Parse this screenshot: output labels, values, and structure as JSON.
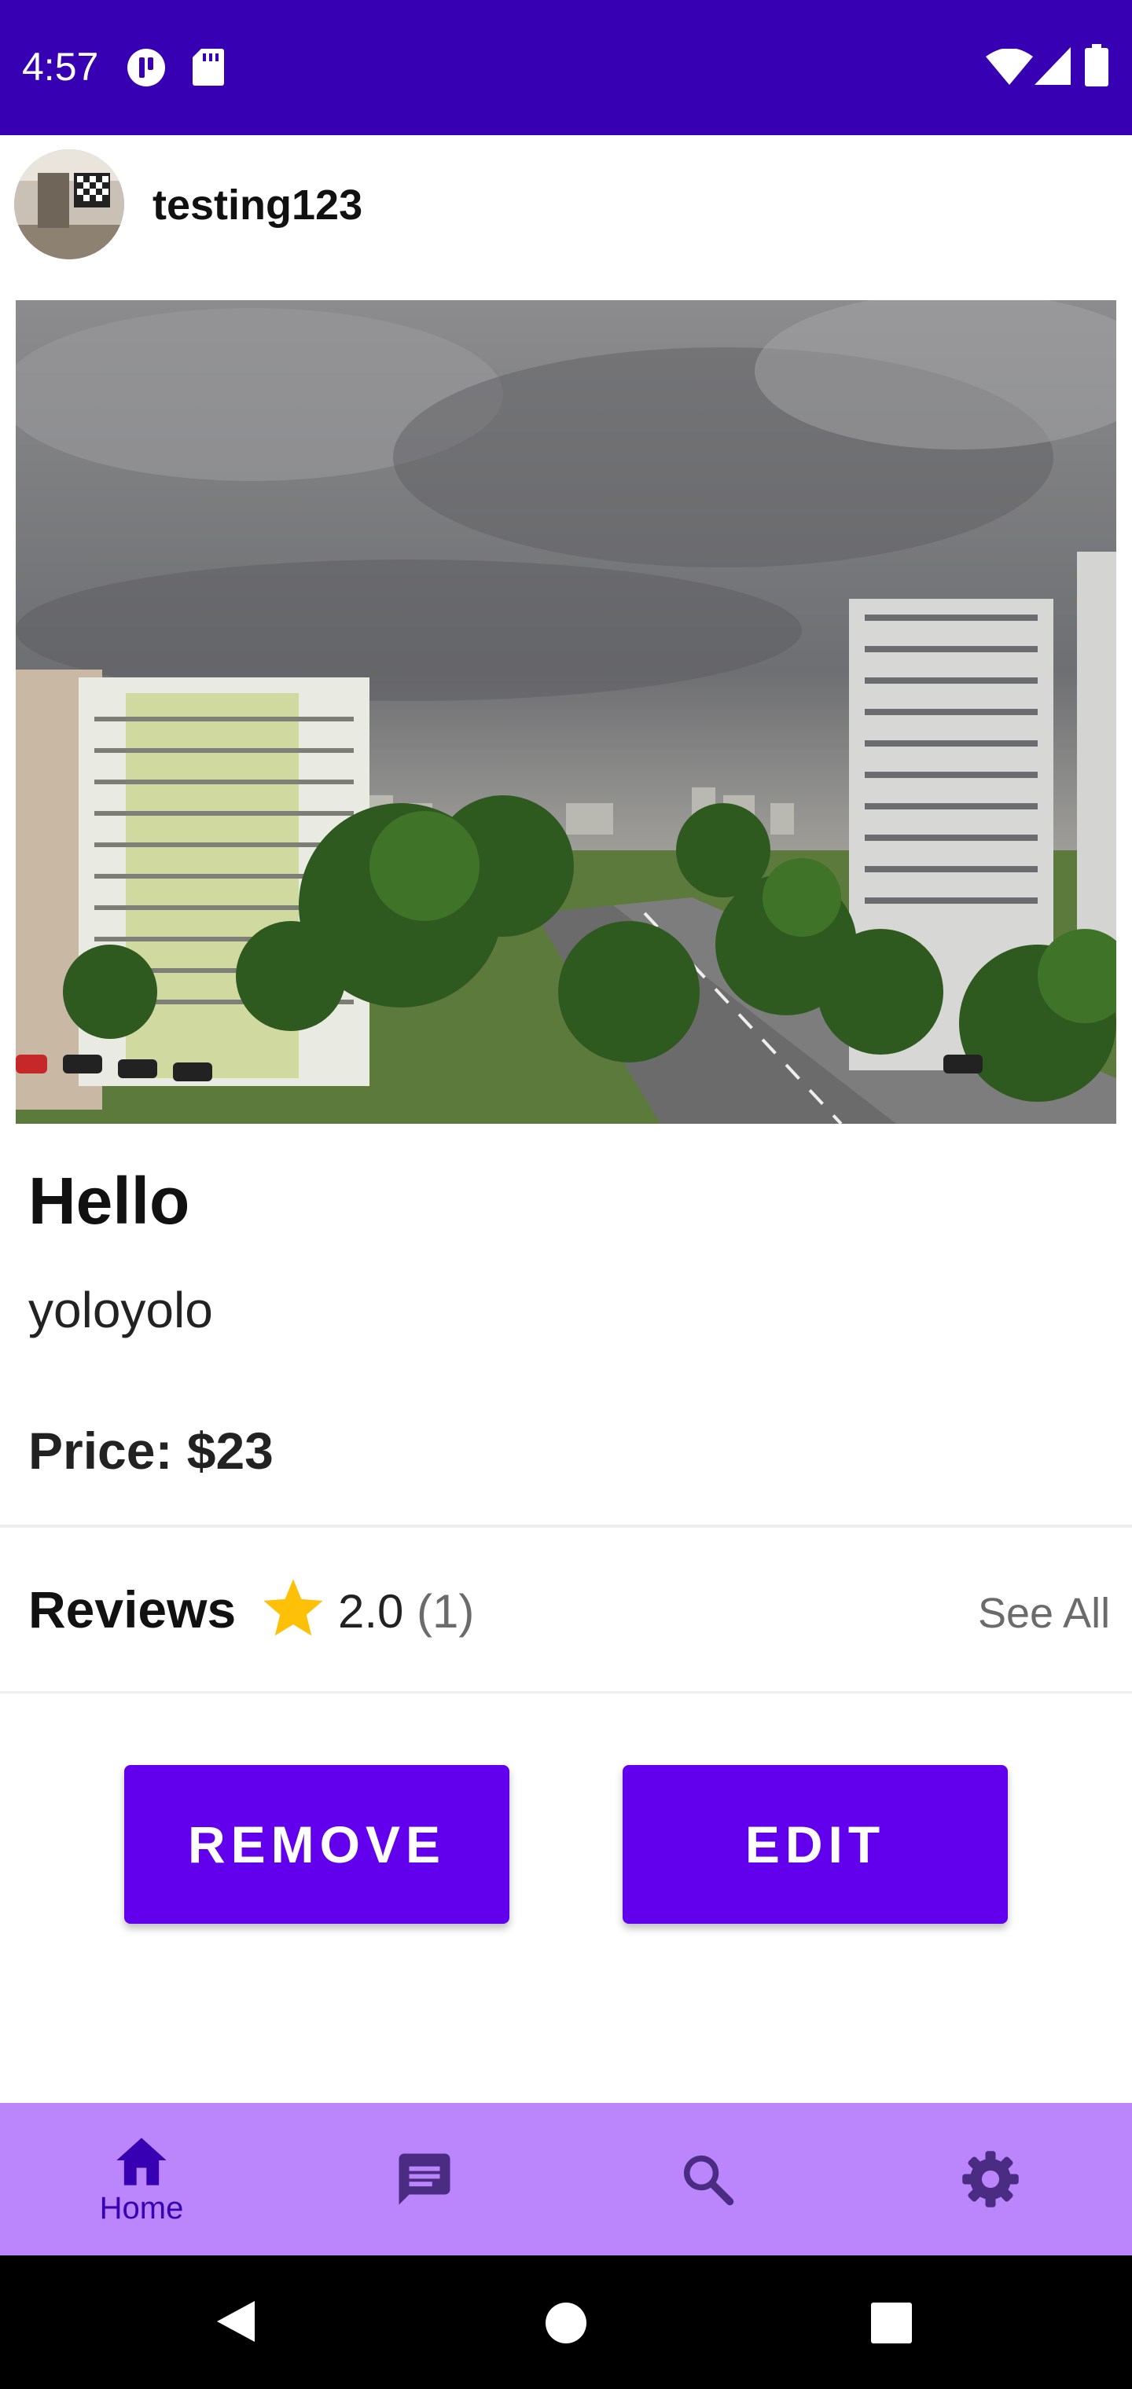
{
  "status_bar": {
    "time": "4:57",
    "icons": [
      "app-notification-icon",
      "sd-card-icon",
      "wifi-icon",
      "cellular-signal-icon",
      "battery-icon"
    ]
  },
  "post": {
    "username": "testing123",
    "title": "Hello",
    "description": "yoloyolo",
    "price": "Price: $23"
  },
  "reviews": {
    "label": "Reviews",
    "rating": "2.0",
    "count": "(1)",
    "see_all": "See All"
  },
  "actions": {
    "remove_label": "REMOVE",
    "edit_label": "EDIT"
  },
  "bottom_nav": {
    "items": [
      {
        "icon": "home-icon",
        "label": "Home",
        "active": true
      },
      {
        "icon": "chat-icon",
        "label": ""
      },
      {
        "icon": "search-icon",
        "label": ""
      },
      {
        "icon": "settings-icon",
        "label": ""
      }
    ]
  },
  "colors": {
    "status_bar": "#3700b3",
    "primary": "#6200ee",
    "bottom_nav": "#bb86fc",
    "active_nav": "#3700b3",
    "star": "#ffc107"
  }
}
